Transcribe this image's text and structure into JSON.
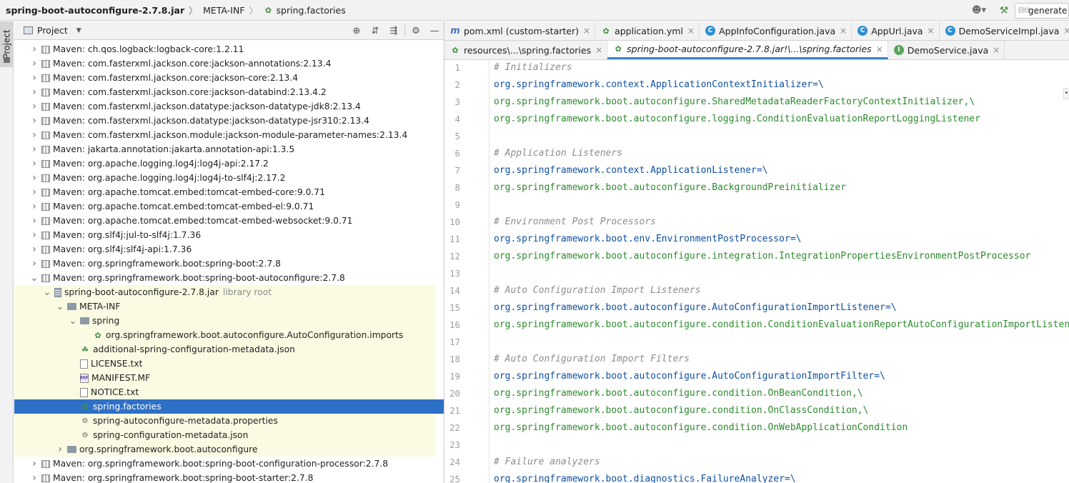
{
  "breadcrumb": {
    "items": [
      "spring-boot-autoconfigure-2.7.8.jar",
      "META-INF",
      "spring.factories"
    ],
    "separator": "〉"
  },
  "toolbar": {
    "run_config_label": "generate",
    "run_config_hint": "回归"
  },
  "sidebar": {
    "stripe_label": "Project"
  },
  "project_panel": {
    "title": "Project",
    "tree": [
      {
        "label": "Maven: ch.qos.logback:logback-core:1.2.11",
        "expand": "collapsed",
        "icon": "library-icon"
      },
      {
        "label": "Maven: com.fasterxml.jackson.core:jackson-annotations:2.13.4",
        "expand": "collapsed",
        "icon": "library-icon"
      },
      {
        "label": "Maven: com.fasterxml.jackson.core:jackson-core:2.13.4",
        "expand": "collapsed",
        "icon": "library-icon"
      },
      {
        "label": "Maven: com.fasterxml.jackson.core:jackson-databind:2.13.4.2",
        "expand": "collapsed",
        "icon": "library-icon"
      },
      {
        "label": "Maven: com.fasterxml.jackson.datatype:jackson-datatype-jdk8:2.13.4",
        "expand": "collapsed",
        "icon": "library-icon"
      },
      {
        "label": "Maven: com.fasterxml.jackson.datatype:jackson-datatype-jsr310:2.13.4",
        "expand": "collapsed",
        "icon": "library-icon"
      },
      {
        "label": "Maven: com.fasterxml.jackson.module:jackson-module-parameter-names:2.13.4",
        "expand": "collapsed",
        "icon": "library-icon"
      },
      {
        "label": "Maven: jakarta.annotation:jakarta.annotation-api:1.3.5",
        "expand": "collapsed",
        "icon": "library-icon"
      },
      {
        "label": "Maven: org.apache.logging.log4j:log4j-api:2.17.2",
        "expand": "collapsed",
        "icon": "library-icon"
      },
      {
        "label": "Maven: org.apache.logging.log4j:log4j-to-slf4j:2.17.2",
        "expand": "collapsed",
        "icon": "library-icon"
      },
      {
        "label": "Maven: org.apache.tomcat.embed:tomcat-embed-core:9.0.71",
        "expand": "collapsed",
        "icon": "library-icon"
      },
      {
        "label": "Maven: org.apache.tomcat.embed:tomcat-embed-el:9.0.71",
        "expand": "collapsed",
        "icon": "library-icon"
      },
      {
        "label": "Maven: org.apache.tomcat.embed:tomcat-embed-websocket:9.0.71",
        "expand": "collapsed",
        "icon": "library-icon"
      },
      {
        "label": "Maven: org.slf4j:jul-to-slf4j:1.7.36",
        "expand": "collapsed",
        "icon": "library-icon"
      },
      {
        "label": "Maven: org.slf4j:slf4j-api:1.7.36",
        "expand": "collapsed",
        "icon": "library-icon"
      },
      {
        "label": "Maven: org.springframework.boot:spring-boot:2.7.8",
        "expand": "collapsed",
        "icon": "library-icon"
      },
      {
        "label": "Maven: org.springframework.boot:spring-boot-autoconfigure:2.7.8",
        "expand": "expanded",
        "icon": "library-icon"
      },
      {
        "label": "spring-boot-autoconfigure-2.7.8.jar",
        "hint": "library root",
        "expand": "expanded",
        "icon": "jar-icon"
      },
      {
        "label": "META-INF",
        "expand": "expanded",
        "icon": "folder-icon"
      },
      {
        "label": "spring",
        "expand": "expanded",
        "icon": "folder-icon"
      },
      {
        "label": "org.springframework.boot.autoconfigure.AutoConfiguration.imports",
        "expand": "none",
        "icon": "spring-file-icon"
      },
      {
        "label": "additional-spring-configuration-metadata.json",
        "expand": "none",
        "icon": "spring-json-icon"
      },
      {
        "label": "LICENSE.txt",
        "expand": "none",
        "icon": "text-file-icon"
      },
      {
        "label": "MANIFEST.MF",
        "expand": "none",
        "icon": "manifest-icon"
      },
      {
        "label": "NOTICE.txt",
        "expand": "none",
        "icon": "text-file-icon"
      },
      {
        "label": "spring.factories",
        "expand": "none",
        "icon": "spring-file-icon",
        "selected": true
      },
      {
        "label": "spring-autoconfigure-metadata.properties",
        "expand": "none",
        "icon": "properties-icon"
      },
      {
        "label": "spring-configuration-metadata.json",
        "expand": "none",
        "icon": "json-icon"
      },
      {
        "label": "org.springframework.boot.autoconfigure",
        "expand": "collapsed",
        "icon": "package-icon"
      },
      {
        "label": "Maven: org.springframework.boot:spring-boot-configuration-processor:2.7.8",
        "expand": "collapsed",
        "icon": "library-icon"
      },
      {
        "label": "Maven: org.springframework.boot:spring-boot-starter:2.7.8",
        "expand": "collapsed",
        "icon": "library-icon"
      }
    ]
  },
  "tabs_row1": [
    {
      "label": "pom.xml (custom-starter)",
      "icon": "maven-icon"
    },
    {
      "label": "application.yml",
      "icon": "yaml-icon"
    },
    {
      "label": "AppInfoConfiguration.java",
      "icon": "class-icon"
    },
    {
      "label": "AppUrl.java",
      "icon": "class-icon"
    },
    {
      "label": "DemoServiceImpl.java",
      "icon": "class-icon"
    }
  ],
  "tabs_row2": [
    {
      "label": "resources\\...\\spring.factories",
      "icon": "spring-file-icon"
    },
    {
      "label": "spring-boot-autoconfigure-2.7.8.jar!\\...\\spring.factories",
      "icon": "spring-file-icon",
      "active": true
    },
    {
      "label": "DemoService.java",
      "icon": "interface-icon"
    }
  ],
  "editor": {
    "lines": [
      {
        "n": "1",
        "text": "# Initializers",
        "kind": "comment"
      },
      {
        "n": "2",
        "text": "org.springframework.context.ApplicationContextInitializer=\\",
        "kind": "key"
      },
      {
        "n": "3",
        "text": "org.springframework.boot.autoconfigure.SharedMetadataReaderFactoryContextInitializer,\\",
        "kind": "value"
      },
      {
        "n": "4",
        "text": "org.springframework.boot.autoconfigure.logging.ConditionEvaluationReportLoggingListener",
        "kind": "value"
      },
      {
        "n": "5",
        "text": "",
        "kind": "blank"
      },
      {
        "n": "6",
        "text": "# Application Listeners",
        "kind": "comment"
      },
      {
        "n": "7",
        "text": "org.springframework.context.ApplicationListener=\\",
        "kind": "key"
      },
      {
        "n": "8",
        "text": "org.springframework.boot.autoconfigure.BackgroundPreinitializer",
        "kind": "value"
      },
      {
        "n": "9",
        "text": "",
        "kind": "blank"
      },
      {
        "n": "10",
        "text": "# Environment Post Processors",
        "kind": "comment"
      },
      {
        "n": "11",
        "text": "org.springframework.boot.env.EnvironmentPostProcessor=\\",
        "kind": "key"
      },
      {
        "n": "12",
        "text": "org.springframework.boot.autoconfigure.integration.IntegrationPropertiesEnvironmentPostProcessor",
        "kind": "value"
      },
      {
        "n": "13",
        "text": "",
        "kind": "blank"
      },
      {
        "n": "14",
        "text": "# Auto Configuration Import Listeners",
        "kind": "comment"
      },
      {
        "n": "15",
        "text": "org.springframework.boot.autoconfigure.AutoConfigurationImportListener=\\",
        "kind": "key"
      },
      {
        "n": "16",
        "text": "org.springframework.boot.autoconfigure.condition.ConditionEvaluationReportAutoConfigurationImportListener",
        "kind": "value"
      },
      {
        "n": "17",
        "text": "",
        "kind": "blank"
      },
      {
        "n": "18",
        "text": "# Auto Configuration Import Filters",
        "kind": "comment"
      },
      {
        "n": "19",
        "text": "org.springframework.boot.autoconfigure.AutoConfigurationImportFilter=\\",
        "kind": "key"
      },
      {
        "n": "20",
        "text": "org.springframework.boot.autoconfigure.condition.OnBeanCondition,\\",
        "kind": "value"
      },
      {
        "n": "21",
        "text": "org.springframework.boot.autoconfigure.condition.OnClassCondition,\\",
        "kind": "value"
      },
      {
        "n": "22",
        "text": "org.springframework.boot.autoconfigure.condition.OnWebApplicationCondition",
        "kind": "value"
      },
      {
        "n": "23",
        "text": "",
        "kind": "blank"
      },
      {
        "n": "24",
        "text": "# Failure analyzers",
        "kind": "comment"
      },
      {
        "n": "25",
        "text": "org.springframework.boot.diagnostics.FailureAnalyzer=\\",
        "kind": "key"
      }
    ]
  },
  "colors": {
    "selection": "#2e70c5",
    "library_root_bg": "#fbfbe3",
    "code_key": "#0f4fa0",
    "code_value": "#2d8a2d",
    "code_comment": "#8c8c8c",
    "active_tab_underline": "#4083c9"
  }
}
